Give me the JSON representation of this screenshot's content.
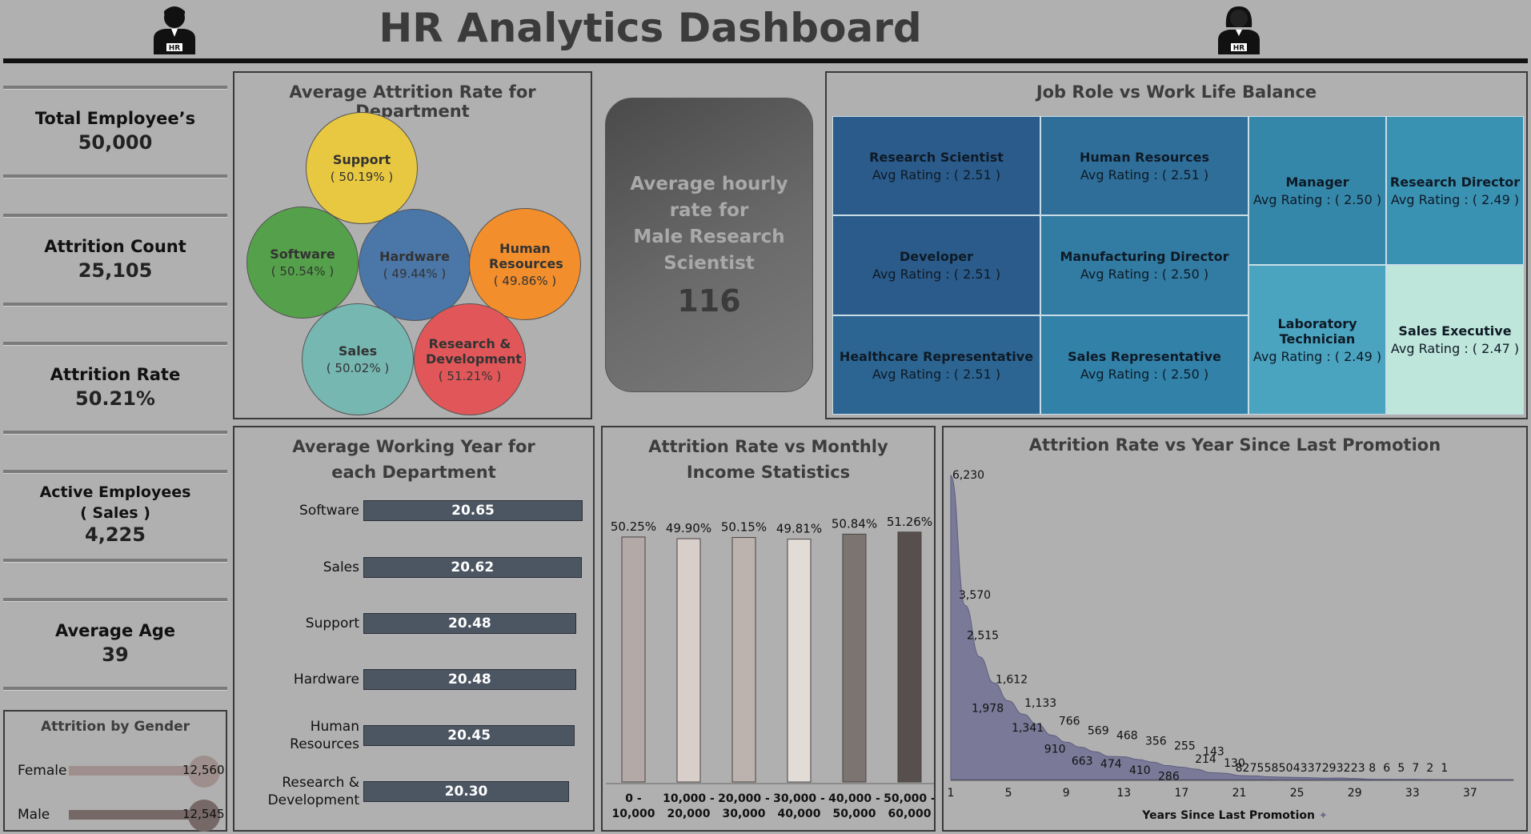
{
  "header": {
    "title": "HR Analytics Dashboard"
  },
  "icons": {
    "left": "male-hr-icon",
    "right": "female-hr-icon",
    "left_badge": "HR",
    "right_badge": "HR"
  },
  "kpis": [
    {
      "label": "Total Employee’s",
      "value": "50,000"
    },
    {
      "label": "Attrition Count",
      "value": "25,105"
    },
    {
      "label": "Attrition Rate",
      "value": "50.21%"
    },
    {
      "label": "Active Employees",
      "label2": "( Sales )",
      "value": "4,225"
    },
    {
      "label": "Average Age",
      "value": "39"
    }
  ],
  "gender": {
    "title": "Attrition by Gender",
    "rows": [
      {
        "label": "Female",
        "value": 12560,
        "value_text": "12,560"
      },
      {
        "label": "Male",
        "value": 12545,
        "value_text": "12,545"
      }
    ]
  },
  "department_attrition": {
    "title": "Average Attrition Rate for Department",
    "bubbles": [
      {
        "name": "Support",
        "pct": "( 50.19% )",
        "color": "#e8c840"
      },
      {
        "name": "Software",
        "pct": "( 50.54% )",
        "color": "#55a04a"
      },
      {
        "name": "Hardware",
        "pct": "( 49.44% )",
        "color": "#4a76a8"
      },
      {
        "name": "Human Resources",
        "pct": "( 49.86% )",
        "color": "#f28e2c"
      },
      {
        "name": "Sales",
        "pct": "( 50.02% )",
        "color": "#76b7b2"
      },
      {
        "name": "Research & Development",
        "pct": "( 51.21% )",
        "color": "#e15759"
      }
    ]
  },
  "hourly_card": {
    "line1": "Average hourly",
    "line2": "rate for",
    "line3": "Male Research",
    "line4": "Scientist",
    "value": "116"
  },
  "treemap": {
    "title": "Job Role vs Work Life Balance",
    "prefix": "Avg Rating :",
    "cells": [
      {
        "role": "Research Scientist",
        "rating": "( 2.51 )",
        "color": "#2b5b8a"
      },
      {
        "role": "Human Resources",
        "rating": "( 2.51 )",
        "color": "#2f6e99"
      },
      {
        "role": "Manager",
        "rating": "( 2.50 )",
        "color": "#3587aa"
      },
      {
        "role": "Research Director",
        "rating": "( 2.49 )",
        "color": "#3a92b3"
      },
      {
        "role": "Developer",
        "rating": "( 2.51 )",
        "color": "#2b5b8a"
      },
      {
        "role": "Manufacturing Director",
        "rating": "( 2.50 )",
        "color": "#327ba2"
      },
      {
        "role": "Healthcare Representative",
        "rating": "( 2.51 )",
        "color": "#2d6592"
      },
      {
        "role": "Sales Representative",
        "rating": "( 2.50 )",
        "color": "#3181a8"
      },
      {
        "role": "Laboratory Technician",
        "rating": "( 2.49 )",
        "color": "#4aa3bf"
      },
      {
        "role": "Sales Executive",
        "rating": "( 2.47 )",
        "color": "#bfe6db"
      }
    ]
  },
  "chart_data": [
    {
      "type": "bar",
      "orientation": "horizontal",
      "title": "Average Working Year for each Department",
      "categories": [
        "Software",
        "Sales",
        "Support",
        "Hardware",
        "Human Resources",
        "Research & Development"
      ],
      "values": [
        20.65,
        20.62,
        20.48,
        20.48,
        20.45,
        20.3
      ]
    },
    {
      "type": "bar",
      "title": "Attrition Rate vs Monthly Income Statistics",
      "categories": [
        "0 - 10,000",
        "10,000 - 20,000",
        "20,000 - 30,000",
        "30,000 - 40,000",
        "40,000 - 50,000",
        "50,000 - 60,000"
      ],
      "values": [
        50.25,
        49.9,
        50.15,
        49.81,
        50.84,
        51.26
      ],
      "value_labels": [
        "50.25%",
        "49.90%",
        "50.15%",
        "49.81%",
        "50.84%",
        "51.26%"
      ],
      "colors": [
        "#b3a9a6",
        "#d8cfca",
        "#bcb2ae",
        "#e2dcd7",
        "#7c7471",
        "#574f4d"
      ]
    },
    {
      "type": "area",
      "title": "Attrition Rate vs Year Since Last Promotion",
      "xlabel": "Years Since Last Promotion",
      "x_ticks": [
        1,
        5,
        9,
        13,
        17,
        21,
        25,
        29,
        33,
        37
      ],
      "x": [
        1,
        2,
        3,
        4,
        5,
        6,
        7,
        8,
        9,
        10,
        11,
        12,
        13,
        14,
        15,
        16,
        17,
        18,
        19,
        20,
        21,
        22,
        23,
        24,
        25,
        26,
        27,
        28,
        29,
        30,
        31,
        32,
        33,
        34,
        35,
        36,
        37,
        38,
        39,
        40
      ],
      "series": [
        {
          "values": [
            6230,
            3570,
            2515,
            1978,
            1612,
            1341,
            1133,
            910,
            766,
            663,
            569,
            474,
            468,
            410,
            356,
            286,
            255,
            214,
            143,
            130,
            82,
            75,
            58,
            50,
            43,
            37,
            29,
            32,
            23,
            8,
            6,
            5,
            7,
            2,
            1,
            1,
            1,
            1,
            1,
            1
          ]
        }
      ],
      "labels": [
        "6,230",
        "3,570",
        "2,515",
        "1,978",
        "1,612",
        "1,341",
        "1,133",
        "910",
        "766",
        "663",
        "569",
        "474",
        "468",
        "410",
        "356",
        "286",
        "255",
        "214",
        "143",
        "130",
        "82",
        "75",
        "58",
        "50",
        "43",
        "37",
        "29",
        "32",
        "23",
        "8",
        "6",
        "5",
        "7",
        "2",
        "1"
      ],
      "color": "#7a7a98"
    }
  ]
}
